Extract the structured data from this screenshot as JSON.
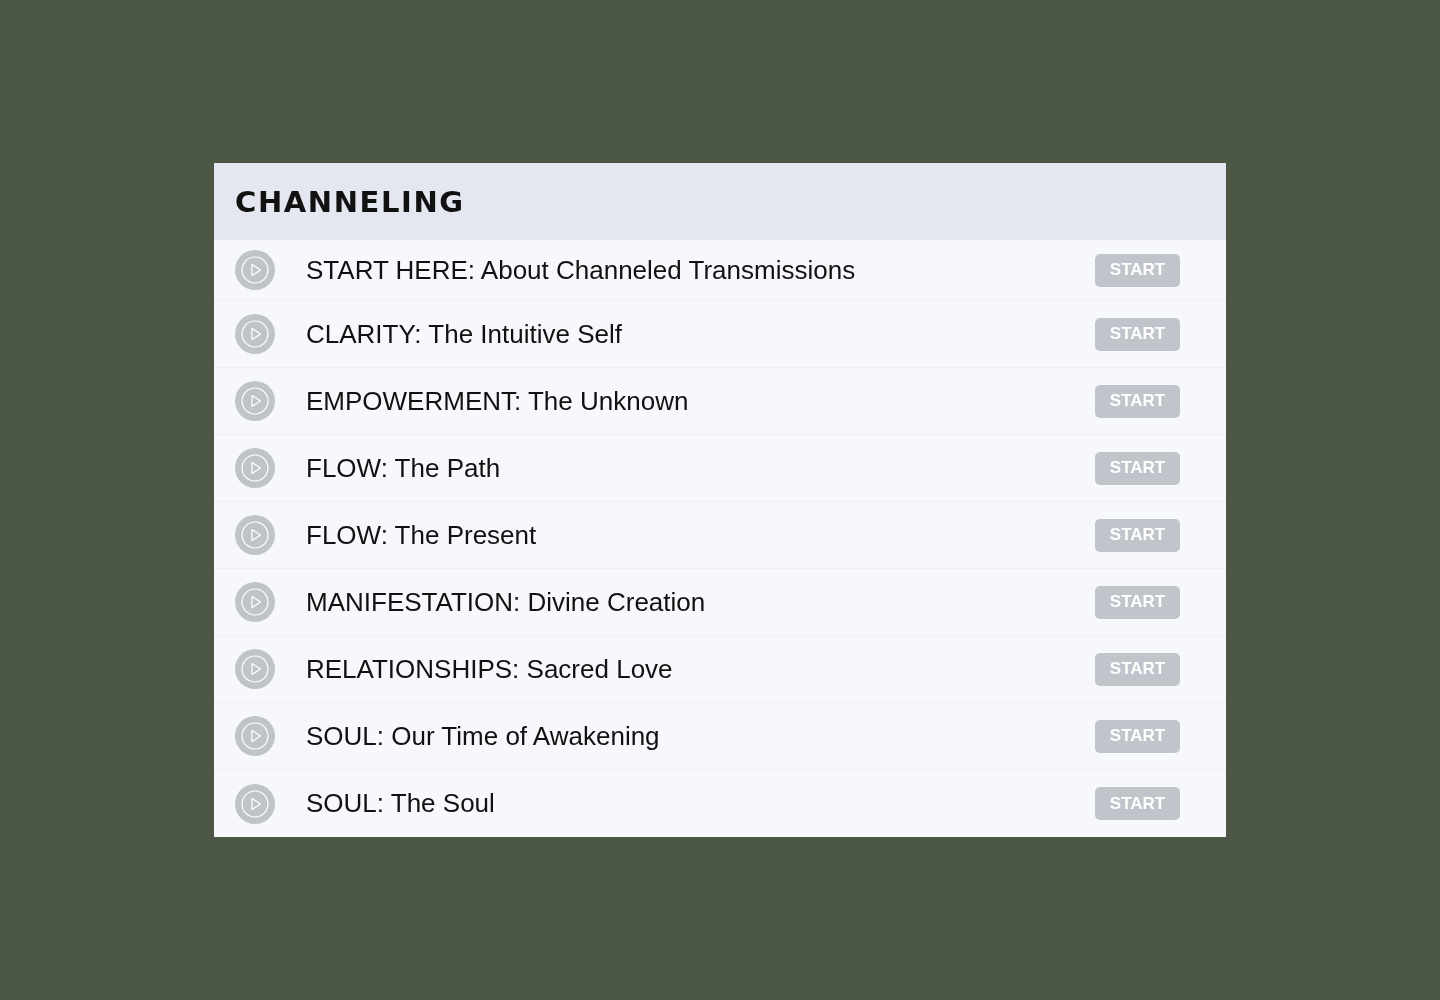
{
  "section": {
    "title": "CHANNELING",
    "lessons": [
      {
        "title": "START HERE: About Channeled Transmissions",
        "button": "START"
      },
      {
        "title": "CLARITY: The Intuitive Self",
        "button": "START"
      },
      {
        "title": "EMPOWERMENT: The Unknown",
        "button": "START"
      },
      {
        "title": "FLOW: The Path",
        "button": "START"
      },
      {
        "title": "FLOW: The Present",
        "button": "START"
      },
      {
        "title": "MANIFESTATION: Divine Creation",
        "button": "START"
      },
      {
        "title": "RELATIONSHIPS: Sacred Love",
        "button": "START"
      },
      {
        "title": "SOUL: Our Time of Awakening",
        "button": "START"
      },
      {
        "title": "SOUL: The Soul",
        "button": "START"
      }
    ]
  }
}
